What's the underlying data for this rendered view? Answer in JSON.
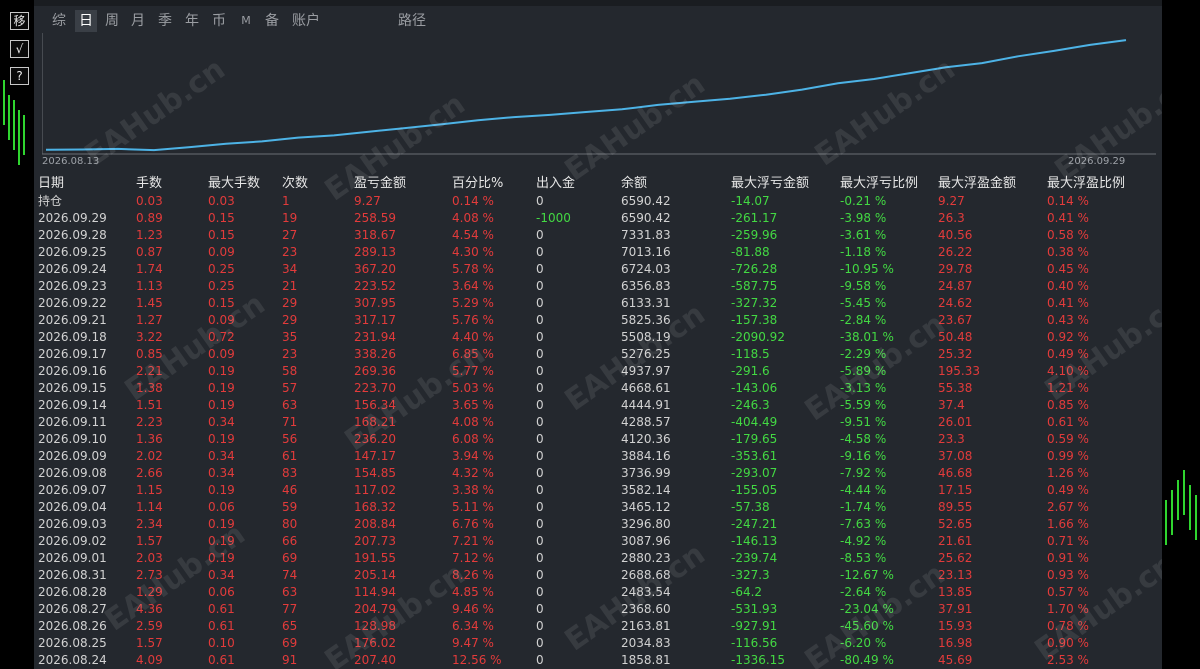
{
  "side_buttons": [
    {
      "icon": "move-icon",
      "glyph": "移"
    },
    {
      "icon": "check-icon",
      "glyph": "√"
    },
    {
      "icon": "help-icon",
      "glyph": "?"
    }
  ],
  "tabs": [
    {
      "label": "综",
      "active": false
    },
    {
      "label": "日",
      "active": true
    },
    {
      "label": "周",
      "active": false
    },
    {
      "label": "月",
      "active": false
    },
    {
      "label": "季",
      "active": false
    },
    {
      "label": "年",
      "active": false
    },
    {
      "label": "币",
      "active": false
    },
    {
      "label": "M",
      "active": false
    },
    {
      "label": "备",
      "active": false
    },
    {
      "label": "账户",
      "active": false
    },
    {
      "label": "路径",
      "active": false
    }
  ],
  "chart": {
    "start_date": "2026.08.13",
    "end_date": "2026.09.29",
    "line_color": "#4db3e6"
  },
  "chart_data": {
    "type": "line",
    "x": [
      "2026.08.13",
      "2026.08.14",
      "2026.08.18",
      "2026.08.22",
      "2026.08.24",
      "2026.08.25",
      "2026.08.26",
      "2026.08.27",
      "2026.08.28",
      "2026.08.31",
      "2026.09.01",
      "2026.09.02",
      "2026.09.03",
      "2026.09.04",
      "2026.09.07",
      "2026.09.08",
      "2026.09.09",
      "2026.09.10",
      "2026.09.11",
      "2026.09.14",
      "2026.09.15",
      "2026.09.16",
      "2026.09.17",
      "2026.09.18",
      "2026.09.21",
      "2026.09.22",
      "2026.09.23",
      "2026.09.24",
      "2026.09.25",
      "2026.09.28",
      "2026.09.29"
    ],
    "series": [
      {
        "values": [
          1720,
          1730,
          1760,
          1700,
          1858.81,
          2034.83,
          2163.81,
          2368.6,
          2483.54,
          2688.68,
          2880.23,
          3087.96,
          3296.8,
          3465.12,
          3582.14,
          3736.99,
          3884.16,
          4120.36,
          4288.57,
          4444.91,
          4668.61,
          4937.97,
          5276.25,
          5508.19,
          5825.36,
          6133.31,
          6356.83,
          6724.03,
          7013.16,
          7331.83,
          7590.42
        ]
      }
    ]
  },
  "table": {
    "headers": [
      "日期",
      "手数",
      "最大手数",
      "次数",
      "盈亏金额",
      "百分比%",
      "出入金",
      "余额",
      "最大浮亏金额",
      "最大浮亏比例",
      "最大浮盈金额",
      "最大浮盈比例"
    ],
    "rows": [
      [
        "持仓",
        "0.03",
        "0.03",
        "1",
        "9.27",
        "0.14 %",
        "0",
        "6590.42",
        "-14.07",
        "-0.21 %",
        "9.27",
        "0.14 %"
      ],
      [
        "2026.09.29",
        "0.89",
        "0.15",
        "19",
        "258.59",
        "4.08 %",
        "-1000",
        "6590.42",
        "-261.17",
        "-3.98 %",
        "26.3",
        "0.41 %"
      ],
      [
        "2026.09.28",
        "1.23",
        "0.15",
        "27",
        "318.67",
        "4.54 %",
        "0",
        "7331.83",
        "-259.96",
        "-3.61 %",
        "40.56",
        "0.58 %"
      ],
      [
        "2026.09.25",
        "0.87",
        "0.09",
        "23",
        "289.13",
        "4.30 %",
        "0",
        "7013.16",
        "-81.88",
        "-1.18 %",
        "26.22",
        "0.38 %"
      ],
      [
        "2026.09.24",
        "1.74",
        "0.25",
        "34",
        "367.20",
        "5.78 %",
        "0",
        "6724.03",
        "-726.28",
        "-10.95 %",
        "29.78",
        "0.45 %"
      ],
      [
        "2026.09.23",
        "1.13",
        "0.25",
        "21",
        "223.52",
        "3.64 %",
        "0",
        "6356.83",
        "-587.75",
        "-9.58 %",
        "24.87",
        "0.40 %"
      ],
      [
        "2026.09.22",
        "1.45",
        "0.15",
        "29",
        "307.95",
        "5.29 %",
        "0",
        "6133.31",
        "-327.32",
        "-5.45 %",
        "24.62",
        "0.41 %"
      ],
      [
        "2026.09.21",
        "1.27",
        "0.09",
        "29",
        "317.17",
        "5.76 %",
        "0",
        "5825.36",
        "-157.38",
        "-2.84 %",
        "23.67",
        "0.43 %"
      ],
      [
        "2026.09.18",
        "3.22",
        "0.72",
        "35",
        "231.94",
        "4.40 %",
        "0",
        "5508.19",
        "-2090.92",
        "-38.01 %",
        "50.48",
        "0.92 %"
      ],
      [
        "2026.09.17",
        "0.85",
        "0.09",
        "23",
        "338.26",
        "6.85 %",
        "0",
        "5276.25",
        "-118.5",
        "-2.29 %",
        "25.32",
        "0.49 %"
      ],
      [
        "2026.09.16",
        "2.21",
        "0.19",
        "58",
        "269.36",
        "5.77 %",
        "0",
        "4937.97",
        "-291.6",
        "-5.89 %",
        "195.33",
        "4.10 %"
      ],
      [
        "2026.09.15",
        "1.38",
        "0.19",
        "57",
        "223.70",
        "5.03 %",
        "0",
        "4668.61",
        "-143.06",
        "-3.13 %",
        "55.38",
        "1.21 %"
      ],
      [
        "2026.09.14",
        "1.51",
        "0.19",
        "63",
        "156.34",
        "3.65 %",
        "0",
        "4444.91",
        "-246.3",
        "-5.59 %",
        "37.4",
        "0.85 %"
      ],
      [
        "2026.09.11",
        "2.23",
        "0.34",
        "71",
        "168.21",
        "4.08 %",
        "0",
        "4288.57",
        "-404.49",
        "-9.51 %",
        "26.01",
        "0.61 %"
      ],
      [
        "2026.09.10",
        "1.36",
        "0.19",
        "56",
        "236.20",
        "6.08 %",
        "0",
        "4120.36",
        "-179.65",
        "-4.58 %",
        "23.3",
        "0.59 %"
      ],
      [
        "2026.09.09",
        "2.02",
        "0.34",
        "61",
        "147.17",
        "3.94 %",
        "0",
        "3884.16",
        "-353.61",
        "-9.16 %",
        "37.08",
        "0.99 %"
      ],
      [
        "2026.09.08",
        "2.66",
        "0.34",
        "83",
        "154.85",
        "4.32 %",
        "0",
        "3736.99",
        "-293.07",
        "-7.92 %",
        "46.68",
        "1.26 %"
      ],
      [
        "2026.09.07",
        "1.15",
        "0.19",
        "46",
        "117.02",
        "3.38 %",
        "0",
        "3582.14",
        "-155.05",
        "-4.44 %",
        "17.15",
        "0.49 %"
      ],
      [
        "2026.09.04",
        "1.14",
        "0.06",
        "59",
        "168.32",
        "5.11 %",
        "0",
        "3465.12",
        "-57.38",
        "-1.74 %",
        "89.55",
        "2.67 %"
      ],
      [
        "2026.09.03",
        "2.34",
        "0.19",
        "80",
        "208.84",
        "6.76 %",
        "0",
        "3296.80",
        "-247.21",
        "-7.63 %",
        "52.65",
        "1.66 %"
      ],
      [
        "2026.09.02",
        "1.57",
        "0.19",
        "66",
        "207.73",
        "7.21 %",
        "0",
        "3087.96",
        "-146.13",
        "-4.92 %",
        "21.61",
        "0.71 %"
      ],
      [
        "2026.09.01",
        "2.03",
        "0.19",
        "69",
        "191.55",
        "7.12 %",
        "0",
        "2880.23",
        "-239.74",
        "-8.53 %",
        "25.62",
        "0.91 %"
      ],
      [
        "2026.08.31",
        "2.73",
        "0.34",
        "74",
        "205.14",
        "8.26 %",
        "0",
        "2688.68",
        "-327.3",
        "-12.67 %",
        "23.13",
        "0.93 %"
      ],
      [
        "2026.08.28",
        "1.29",
        "0.06",
        "63",
        "114.94",
        "4.85 %",
        "0",
        "2483.54",
        "-64.2",
        "-2.64 %",
        "13.85",
        "0.57 %"
      ],
      [
        "2026.08.27",
        "4.36",
        "0.61",
        "77",
        "204.79",
        "9.46 %",
        "0",
        "2368.60",
        "-531.93",
        "-23.04 %",
        "37.91",
        "1.70 %"
      ],
      [
        "2026.08.26",
        "2.59",
        "0.61",
        "65",
        "128.98",
        "6.34 %",
        "0",
        "2163.81",
        "-927.91",
        "-45.60 %",
        "15.93",
        "0.78 %"
      ],
      [
        "2026.08.25",
        "1.57",
        "0.10",
        "69",
        "176.02",
        "9.47 %",
        "0",
        "2034.83",
        "-116.56",
        "-6.20 %",
        "16.98",
        "0.90 %"
      ],
      [
        "2026.08.24",
        "4.09",
        "0.61",
        "91",
        "207.40",
        "12.56 %",
        "0",
        "1858.81",
        "-1336.15",
        "-80.49 %",
        "45.69",
        "2.53 %"
      ]
    ]
  },
  "colors": {
    "positive": "#e23b3b",
    "drawdown": "#43d943",
    "neutral": "#d2d2d2",
    "panel": "#24282e"
  },
  "watermark": "EAHub.cn"
}
